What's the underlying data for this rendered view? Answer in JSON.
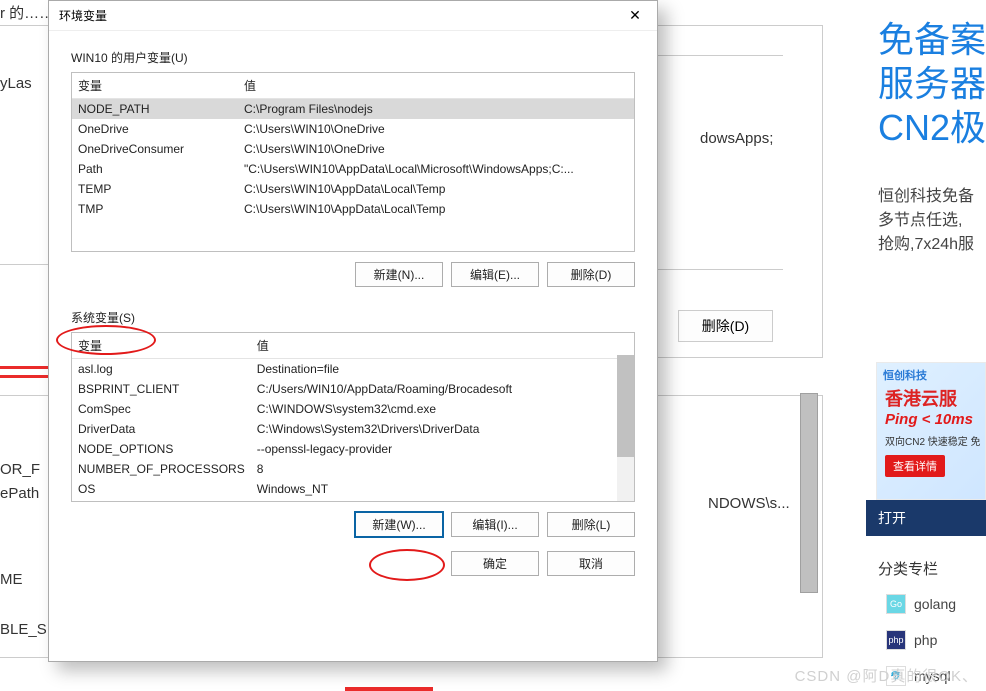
{
  "background": {
    "top_fragment": "r 的……",
    "ylas_fragment": "yLas",
    "windowsapps_fragment": "dowsApps;",
    "delete_btn": "删除(D)",
    "or_path_fragment_line1": "OR_F",
    "or_path_fragment_line2": "ePath",
    "ndows_fragment": "NDOWS\\s...",
    "me_fragment": "ME",
    "ble_fragment": "BLE_S"
  },
  "dialog": {
    "title": "环境变量",
    "user_vars_label": "WIN10 的用户变量(U)",
    "system_vars_label": "系统变量(S)",
    "col_var": "变量",
    "col_val": "值",
    "user_vars": [
      {
        "name": "NODE_PATH",
        "value": "C:\\Program Files\\nodejs",
        "selected": true
      },
      {
        "name": "OneDrive",
        "value": "C:\\Users\\WIN10\\OneDrive",
        "selected": false
      },
      {
        "name": "OneDriveConsumer",
        "value": "C:\\Users\\WIN10\\OneDrive",
        "selected": false
      },
      {
        "name": "Path",
        "value": "\"C:\\Users\\WIN10\\AppData\\Local\\Microsoft\\WindowsApps;C:...",
        "selected": false
      },
      {
        "name": "TEMP",
        "value": "C:\\Users\\WIN10\\AppData\\Local\\Temp",
        "selected": false
      },
      {
        "name": "TMP",
        "value": "C:\\Users\\WIN10\\AppData\\Local\\Temp",
        "selected": false
      }
    ],
    "system_vars": [
      {
        "name": "asl.log",
        "value": "Destination=file"
      },
      {
        "name": "BSPRINT_CLIENT",
        "value": "C:/Users/WIN10/AppData/Roaming/Brocadesoft"
      },
      {
        "name": "ComSpec",
        "value": "C:\\WINDOWS\\system32\\cmd.exe"
      },
      {
        "name": "DriverData",
        "value": "C:\\Windows\\System32\\Drivers\\DriverData"
      },
      {
        "name": "NODE_OPTIONS",
        "value": "--openssl-legacy-provider"
      },
      {
        "name": "NUMBER_OF_PROCESSORS",
        "value": "8"
      },
      {
        "name": "OS",
        "value": "Windows_NT"
      }
    ],
    "buttons": {
      "user_new": "新建(N)...",
      "user_edit": "编辑(E)...",
      "user_delete": "删除(D)",
      "sys_new": "新建(W)...",
      "sys_edit": "编辑(I)...",
      "sys_delete": "删除(L)",
      "ok": "确定",
      "cancel": "取消"
    }
  },
  "sidebar": {
    "promo_title_line1": "免备案",
    "promo_title_line2": "服务器",
    "promo_title_line3": "CN2极",
    "promo_text_line1": "恒创科技免备",
    "promo_text_line2": "多节点任选,",
    "promo_text_line3": "抢购,7x24h服",
    "ad_logo": "恒创科技",
    "ad_text": "香港云服",
    "ad_ping": "Ping < 10ms",
    "ad_sub": "双向CN2  快速稳定  免",
    "ad_btn": "查看详情",
    "open": "打开",
    "cat_title": "分类专栏",
    "cat1": "golang",
    "cat2": "php",
    "cat3": "mysql"
  },
  "watermark": "CSDN @阿D真的很OK、"
}
